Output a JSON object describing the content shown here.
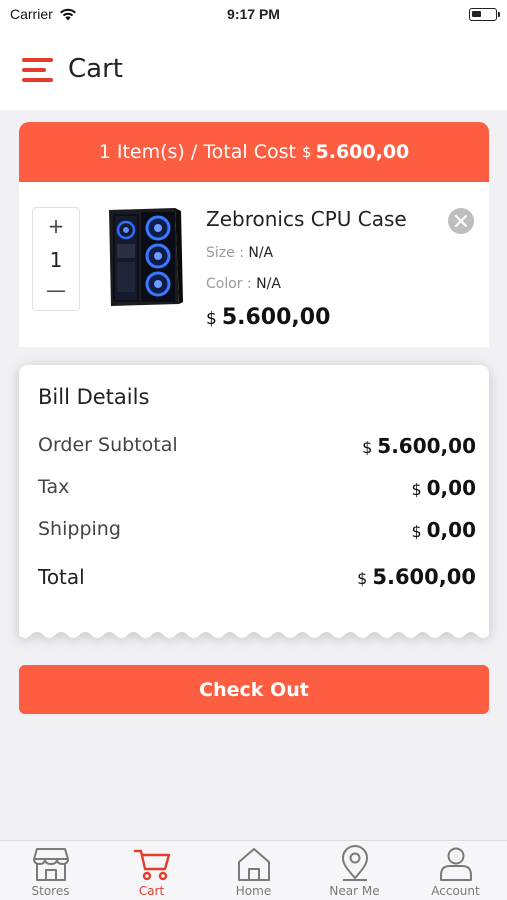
{
  "status_bar": {
    "carrier": "Carrier",
    "time": "9:17 PM"
  },
  "header": {
    "title": "Cart"
  },
  "summary": {
    "text": "1 Item(s) / Total Cost",
    "currency": "$",
    "amount": "5.600,00"
  },
  "cart_item": {
    "quantity": "1",
    "name": "Zebronics CPU Case",
    "size_label": "Size :",
    "size_value": "N/A",
    "color_label": "Color :",
    "color_value": "N/A",
    "price_currency": "$",
    "price": "5.600,00"
  },
  "bill": {
    "title": "Bill Details",
    "rows": [
      {
        "label": "Order Subtotal",
        "currency": "$",
        "value": "5.600,00"
      },
      {
        "label": "Tax",
        "currency": "$",
        "value": "0,00"
      },
      {
        "label": "Shipping",
        "currency": "$",
        "value": "0,00"
      },
      {
        "label": "Total",
        "currency": "$",
        "value": "5.600,00"
      }
    ]
  },
  "checkout": {
    "label": "Check Out"
  },
  "tabs": [
    {
      "label": "Stores",
      "icon": "store-icon",
      "active": false
    },
    {
      "label": "Cart",
      "icon": "cart-icon",
      "active": true
    },
    {
      "label": "Home",
      "icon": "home-icon",
      "active": false
    },
    {
      "label": "Near Me",
      "icon": "location-pin-icon",
      "active": false
    },
    {
      "label": "Account",
      "icon": "user-icon",
      "active": false
    }
  ],
  "colors": {
    "accent": "#fd5e42",
    "accent_dark": "#e33c2c",
    "inactive": "#7a7a7a",
    "background": "#f1f1f5"
  }
}
